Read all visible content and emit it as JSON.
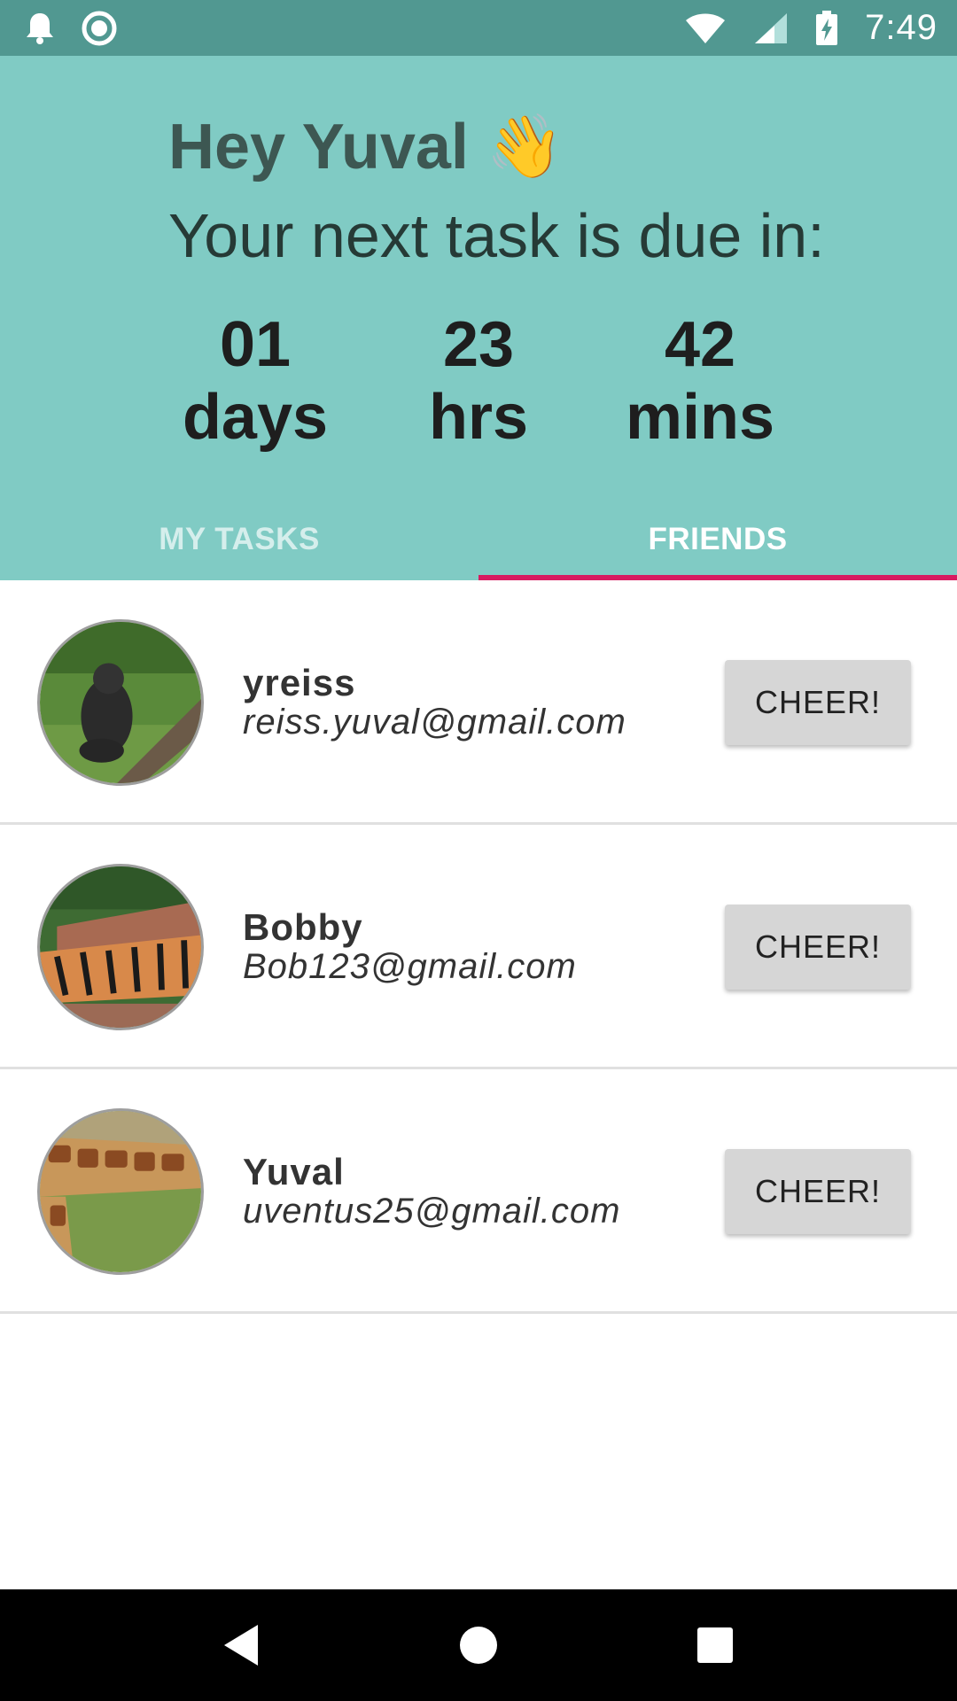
{
  "status_bar": {
    "time": "7:49",
    "icons": [
      "bell-icon",
      "sync-icon",
      "wifi-icon",
      "signal-icon",
      "battery-charging-icon"
    ]
  },
  "header": {
    "greeting": "Hey Yuval",
    "wave_emoji": "👋",
    "due_text": "Your next task is due in:",
    "countdown": [
      {
        "value": "01",
        "label": "days"
      },
      {
        "value": "23",
        "label": "hrs"
      },
      {
        "value": "42",
        "label": "mins"
      }
    ]
  },
  "tabs": [
    {
      "label": "MY TASKS",
      "active": false
    },
    {
      "label": "FRIENDS",
      "active": true
    }
  ],
  "friends": [
    {
      "name": "yreiss",
      "email": "reiss.yuval@gmail.com",
      "avatar": "gorilla-photo",
      "button_label": "CHEER!"
    },
    {
      "name": "Bobby",
      "email": "Bob123@gmail.com",
      "avatar": "tiger-photo",
      "button_label": "CHEER!"
    },
    {
      "name": "Yuval",
      "email": "uventus25@gmail.com",
      "avatar": "giraffe-photo",
      "button_label": "CHEER!"
    }
  ],
  "nav_bar": {
    "buttons": [
      "back-icon",
      "home-icon",
      "recents-icon"
    ]
  },
  "colors": {
    "status_bar": "#519891",
    "header": "#80cbc4",
    "tab_indicator": "#d81b60",
    "button": "#d6d6d6"
  }
}
